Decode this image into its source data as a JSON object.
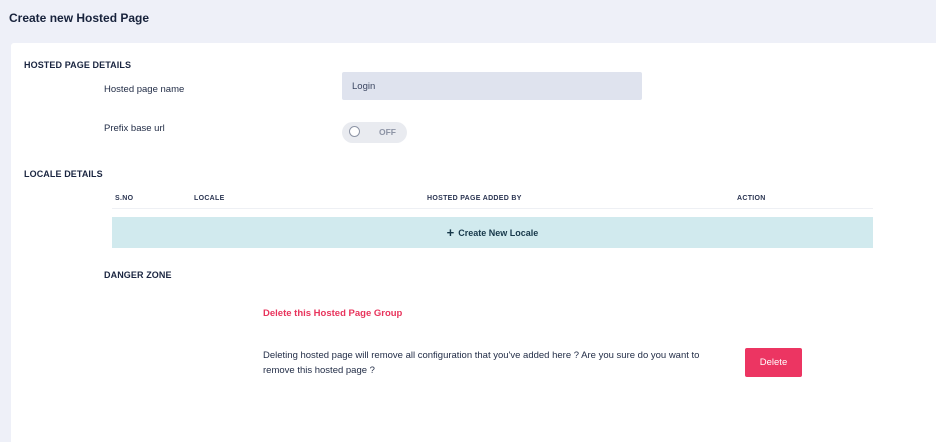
{
  "header": {
    "title": "Create new Hosted Page"
  },
  "hosted_page_details": {
    "section_title": "HOSTED PAGE DETAILS",
    "name_label": "Hosted page name",
    "name_value": "Login",
    "prefix_label": "Prefix base url",
    "prefix_toggle_state": "OFF"
  },
  "locale_details": {
    "section_title": "LOCALE DETAILS",
    "columns": [
      "S.NO",
      "LOCALE",
      "HOSTED PAGE ADDED BY",
      "ACTION"
    ],
    "rows": [],
    "create_label": "Create New Locale",
    "create_icon": "plus-icon"
  },
  "danger_zone": {
    "section_title": "DANGER ZONE",
    "link_label": "Delete this Hosted Page Group",
    "warning_text": "Deleting hosted page will remove all configuration that you've added here ? Are you sure do you want to remove this hosted page ?",
    "delete_label": "Delete"
  },
  "colors": {
    "background": "#eef0f8",
    "card": "#ffffff",
    "input_bg": "#dfe3ee",
    "create_bar": "#d1eaee",
    "danger": "#e8345c",
    "delete_button": "#ec3562"
  }
}
